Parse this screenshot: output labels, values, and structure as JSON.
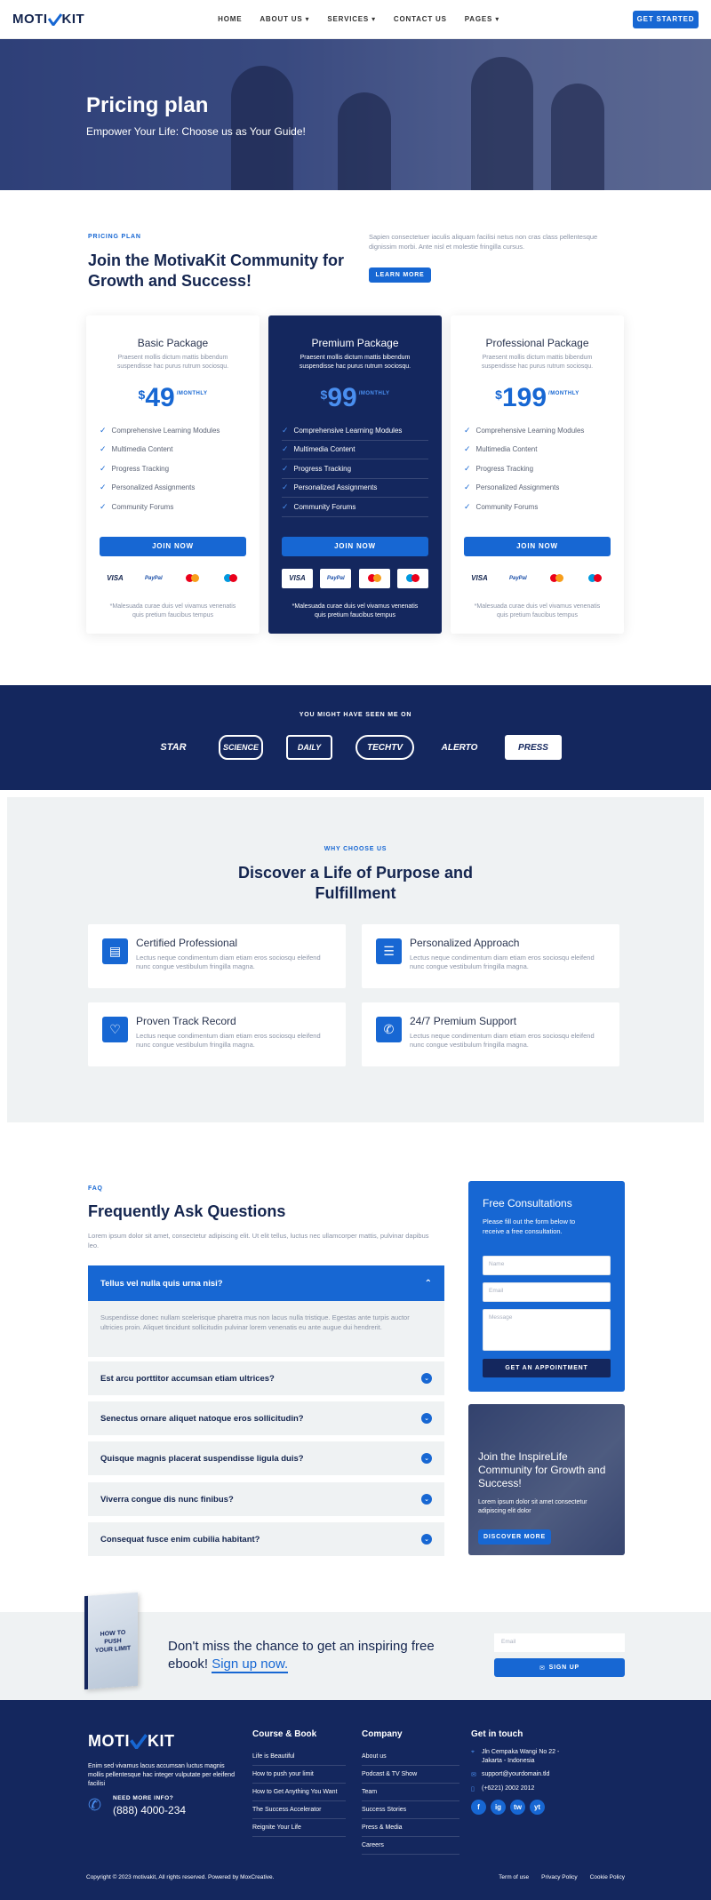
{
  "nav": {
    "logo_a": "MOTI",
    "logo_b": "KIT",
    "items": [
      "HOME",
      "ABOUT US",
      "SERVICES",
      "CONTACT US",
      "PAGES"
    ],
    "cta": "GET STARTED"
  },
  "hero": {
    "title": "Pricing plan",
    "subtitle": "Empower Your Life: Choose us as Your Guide!"
  },
  "pricing_intro": {
    "eyebrow": "PRICING PLAN",
    "title": "Join the MotivaKit Community for Growth and Success!",
    "text": "Sapien consectetuer iaculis aliquam facilisi netus non cras class pellentesque dignissim morbi. Ante nisl et molestie fringilla cursus.",
    "button": "LEARN MORE"
  },
  "plans": [
    {
      "name": "Basic Package",
      "desc": "Praesent mollis dictum mattis bibendum suspendisse hac purus rutrum sociosqu.",
      "currency": "$",
      "amount": "49",
      "period": "/MONTHLY",
      "features": [
        "Comprehensive Learning Modules",
        "Multimedia Content",
        "Progress Tracking",
        "Personalized Assignments",
        "Community Forums"
      ],
      "button": "JOIN NOW",
      "note": "*Malesuada curae duis vel vivamus venenatis quis pretium faucibus tempus"
    },
    {
      "name": "Premium Package",
      "desc": "Praesent mollis dictum mattis bibendum suspendisse hac purus rutrum sociosqu.",
      "currency": "$",
      "amount": "99",
      "period": "/MONTHLY",
      "features": [
        "Comprehensive Learning Modules",
        "Multimedia Content",
        "Progress Tracking",
        "Personalized Assignments",
        "Community Forums"
      ],
      "button": "JOIN NOW",
      "note": "*Malesuada curae duis vel vivamus venenatis quis pretium faucibus tempus"
    },
    {
      "name": "Professional Package",
      "desc": "Praesent mollis dictum mattis bibendum suspendisse hac purus rutrum sociosqu.",
      "currency": "$",
      "amount": "199",
      "period": "/MONTHLY",
      "features": [
        "Comprehensive Learning Modules",
        "Multimedia Content",
        "Progress Tracking",
        "Personalized Assignments",
        "Community Forums"
      ],
      "button": "JOIN NOW",
      "note": "*Malesuada curae duis vel vivamus venenatis quis pretium faucibus tempus"
    }
  ],
  "payments": [
    "VISA",
    "PayPal",
    "mastercard",
    "maestro"
  ],
  "press": {
    "title": "YOU MIGHT HAVE SEEN ME ON",
    "logos": [
      "STAR",
      "SCIENCE",
      "DAILY",
      "TECHTV",
      "ALERTO",
      "PRESS"
    ]
  },
  "why": {
    "eyebrow": "WHY CHOOSE US",
    "title": "Discover a Life of Purpose and Fulfillment",
    "features": [
      {
        "title": "Certified Professional",
        "text": "Lectus neque condimentum diam etiam eros sociosqu eleifend nunc congue vestibulum fringilla magna.",
        "icon": "certificate-icon"
      },
      {
        "title": "Personalized Approach",
        "text": "Lectus neque condimentum diam etiam eros sociosqu eleifend nunc congue vestibulum fringilla magna.",
        "icon": "document-icon"
      },
      {
        "title": "Proven Track Record",
        "text": "Lectus neque condimentum diam etiam eros sociosqu eleifend nunc congue vestibulum fringilla magna.",
        "icon": "heart-pulse-icon"
      },
      {
        "title": "24/7 Premium Support",
        "text": "Lectus neque condimentum diam etiam eros sociosqu eleifend nunc congue vestibulum fringilla magna.",
        "icon": "support-icon"
      }
    ]
  },
  "faq": {
    "eyebrow": "FAQ",
    "title": "Frequently Ask Questions",
    "text": "Lorem ipsum dolor sit amet, consectetur adipiscing elit. Ut elit tellus, luctus nec ullamcorper mattis, pulvinar dapibus leo.",
    "open_question": "Tellus vel nulla quis urna nisi?",
    "open_answer": "Suspendisse donec nullam scelerisque pharetra mus non lacus nulla tristique. Egestas ante turpis auctor ultricies proin. Aliquet tincidunt sollicitudin pulvinar lorem venenatis eu ante augue dui hendrerit.",
    "questions": [
      "Est arcu porttitor accumsan etiam ultrices?",
      "Senectus ornare aliquet natoque eros sollicitudin?",
      "Quisque magnis placerat suspendisse ligula duis?",
      "Viverra congue dis nunc finibus?",
      "Consequat fusce enim cubilia habitant?"
    ]
  },
  "consult": {
    "title": "Free Consultations",
    "text": "Please fill out the form below to receive a free consultation.",
    "name_ph": "Name",
    "email_ph": "Email",
    "message_ph": "Message",
    "button": "GET AN APPOINTMENT"
  },
  "promo": {
    "title": "Join the InspireLife Community for Growth and Success!",
    "text": "Lorem ipsum dolor sit amet consectetur adipiscing elit dolor",
    "button": "DISCOVER MORE"
  },
  "newsletter": {
    "book_lines": [
      "HOW TO PUSH",
      "YOUR LIMIT"
    ],
    "title": "Don't miss the chance to get an inspiring free ebook!",
    "link": "Sign up now.",
    "email_ph": "Email",
    "button": "SIGN UP"
  },
  "footer": {
    "about": "Enim sed vivamus lacus accumsan luctus magnis mollis pellentesque hac integer vulputate per eleifend facilisi",
    "need_info": "NEED MORE INFO?",
    "phone": "(888) 4000-234",
    "col1_title": "Course & Book",
    "col1": [
      "Life is Beautiful",
      "How to push your limit",
      "How to Get Anything You Want",
      "The Success Accelerator",
      "Reignite Your Life"
    ],
    "col2_title": "Company",
    "col2": [
      "About us",
      "Podcast & TV Show",
      "Team",
      "Success Stories",
      "Press & Media",
      "Careers"
    ],
    "contact_title": "Get in touch",
    "address": "Jln Cempaka Wangi No 22 - Jakarta - Indonesia",
    "email": "support@yourdomain.tld",
    "tel": "(+6221) 2002 2012",
    "socials": [
      "f",
      "ig",
      "tw",
      "yt"
    ],
    "copyright": "Copyright © 2023 motivakit, All rights reserved. Powered by MoxCreative.",
    "legal": [
      "Term of use",
      "Privacy Policy",
      "Cookie Policy"
    ]
  },
  "colors": {
    "accent": "#1767d3",
    "navy": "#14275e",
    "light_bg": "#eff2f3"
  }
}
